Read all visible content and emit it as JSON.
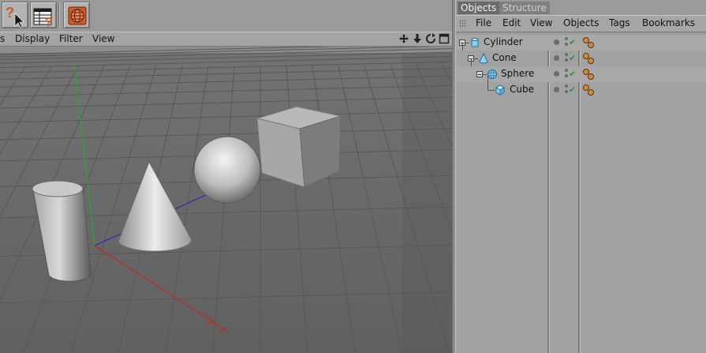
{
  "toolbar": {
    "buttons": [
      {
        "name": "help-arrow-icon"
      },
      {
        "name": "help-table-icon"
      },
      {
        "name": "render-globe-icon"
      }
    ]
  },
  "viewport": {
    "menu": [
      "s",
      "Display",
      "Filter",
      "View"
    ],
    "nav_icons": [
      "move-view-icon",
      "down-arrow-icon",
      "rotate-view-icon",
      "maximize-view-icon"
    ],
    "objects_in_scene": [
      "cylinder",
      "cone",
      "sphere",
      "cube"
    ]
  },
  "object_manager": {
    "tabs": [
      "Objects",
      "Structure"
    ],
    "menu": [
      "File",
      "Edit",
      "View",
      "Objects",
      "Tags",
      "Bookmarks"
    ],
    "rows": [
      {
        "name": "Cylinder",
        "icon": "cylinder-icon",
        "depth": 0
      },
      {
        "name": "Cone",
        "icon": "cone-icon",
        "depth": 1
      },
      {
        "name": "Sphere",
        "icon": "sphere-icon",
        "depth": 2
      },
      {
        "name": "Cube",
        "icon": "cube-icon",
        "depth": 3
      }
    ],
    "accent_color": "#6b6b6b"
  }
}
